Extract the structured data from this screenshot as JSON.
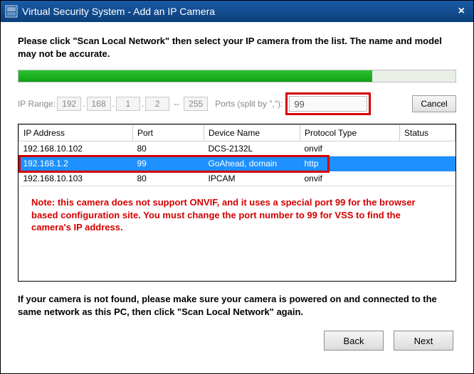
{
  "window": {
    "title": "Virtual Security System - Add an IP Camera"
  },
  "instructions": {
    "top": "Please click \"Scan Local Network\" then select your IP camera from the list. The name and model may not be accurate.",
    "bottom": "If your camera is not found, please make sure your camera is powered on and connected to the same network as this PC, then click \"Scan Local Network\" again."
  },
  "progress": {
    "percent": 81
  },
  "iprange": {
    "label": "IP Range:",
    "octet1": "192",
    "octet2": "168",
    "octet3": "1",
    "octet4": "2",
    "end_octet": "255",
    "ports_label": "Ports (split by \",\"):",
    "ports_value": "99"
  },
  "buttons": {
    "cancel": "Cancel",
    "back": "Back",
    "next": "Next"
  },
  "table": {
    "headers": {
      "ip": "IP Address",
      "port": "Port",
      "device": "Device Name",
      "protocol": "Protocol Type",
      "status": "Status"
    },
    "rows": [
      {
        "ip": "192.168.10.102",
        "port": "80",
        "device": "DCS-2132L",
        "protocol": "onvif",
        "status": ""
      },
      {
        "ip": "192.168.1.2",
        "port": "99",
        "device": "GoAhead, domain",
        "protocol": "http",
        "status": ""
      },
      {
        "ip": "192.168.10.103",
        "port": "80",
        "device": "IPCAM",
        "protocol": "onvif",
        "status": ""
      }
    ],
    "selected_index": 1
  },
  "note": "Note: this camera does not support ONVIF, and it uses a special port 99 for the browser based configuration site. You must change the port number to 99 for VSS to find the camera's IP address."
}
